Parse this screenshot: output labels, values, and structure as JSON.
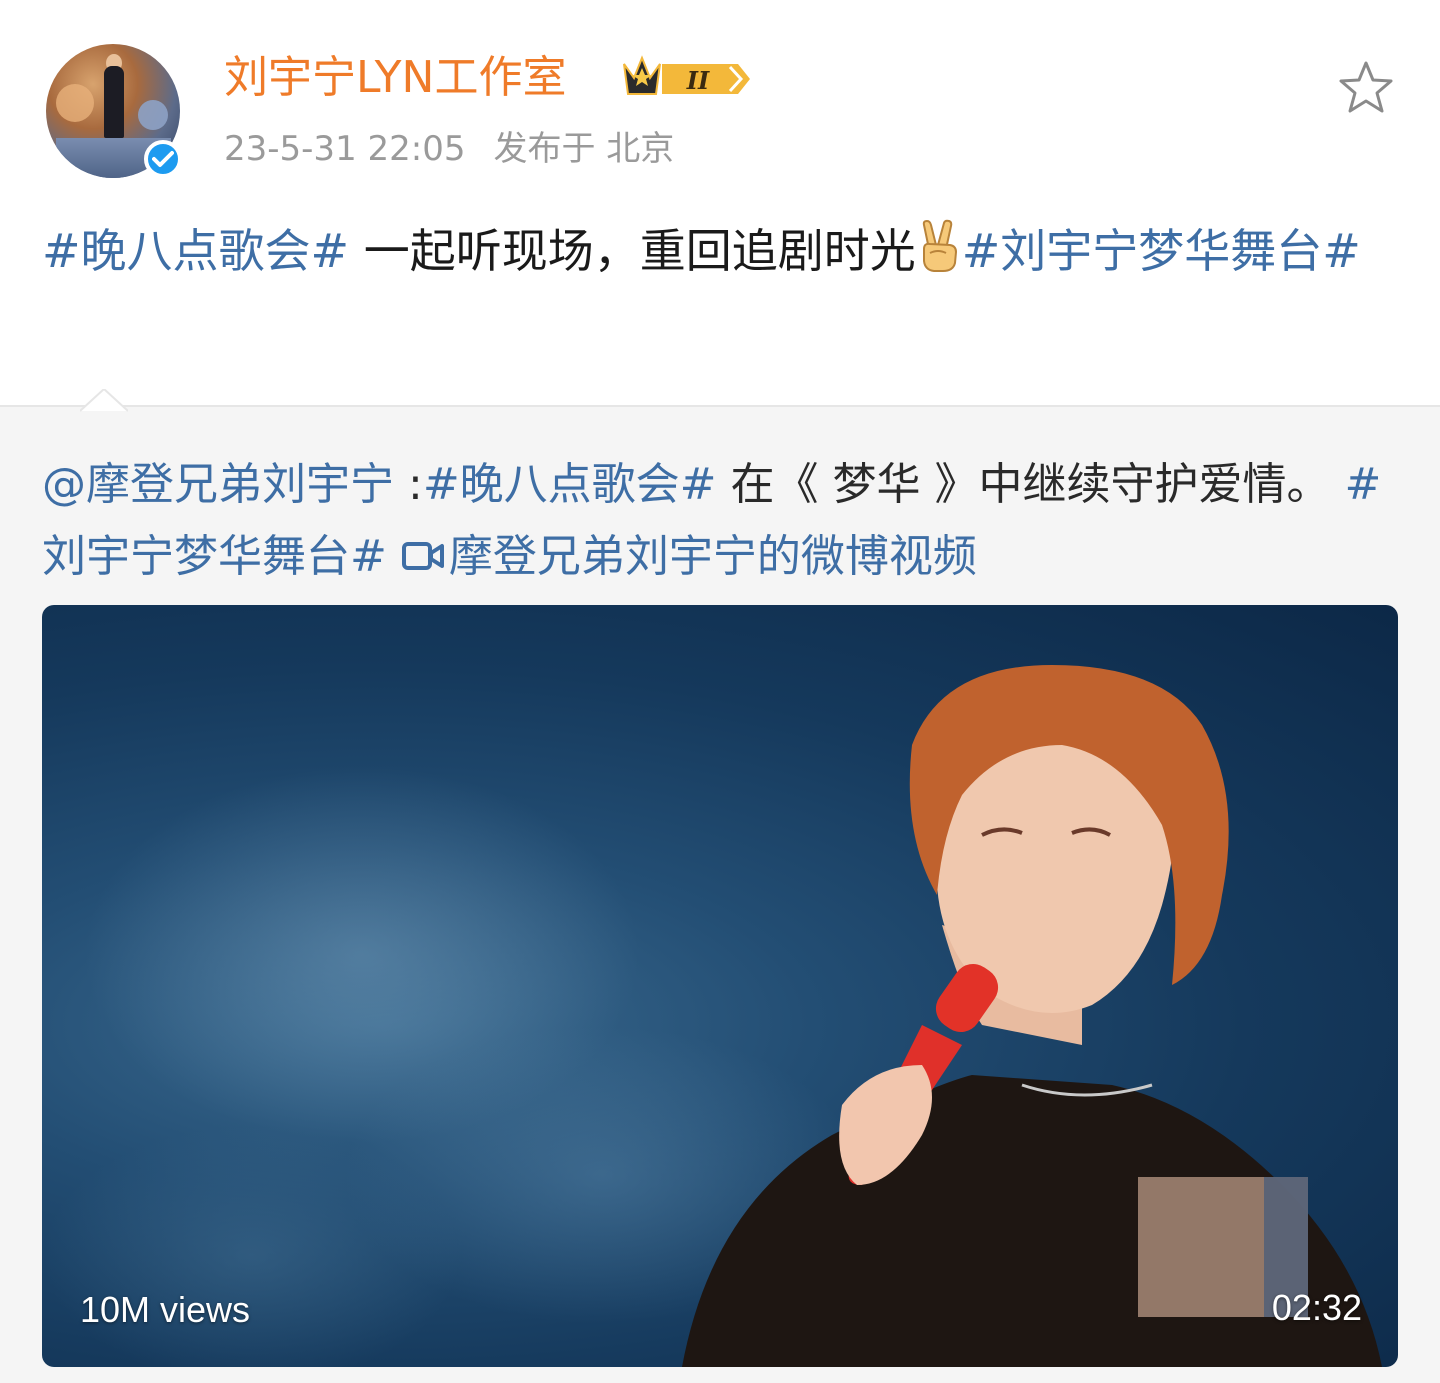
{
  "author": {
    "name": "刘宇宁LYN工作室",
    "avatar_caption": "刘宇宁",
    "verified_icon": "verified-check-icon",
    "vip_badge_level": "II",
    "timestamp": "23-5-31 22:05",
    "location": "发布于 北京",
    "name_color": "#ef7b29"
  },
  "post": {
    "tag1": "#晚八点歌会#",
    "text1": " 一起听现场，重回追剧时光",
    "emoji": "victory-hand-emoji",
    "tag2": "#刘宇宁梦华舞台#"
  },
  "repost": {
    "mention": "@摩登兄弟刘宇宁",
    "separator": " :",
    "tag1": "#晚八点歌会#",
    "text1": " 在《 梦华 》中继续守护爱情。 ",
    "tag2": "#刘宇宁梦华舞台#",
    "video_link": "摩登兄弟刘宇宁的微博视频",
    "video_link_icon": "video-camera-icon"
  },
  "video": {
    "views": "10M views",
    "duration": "02:32"
  },
  "colors": {
    "link": "#3e6ea5",
    "meta": "#9a9a9a",
    "repost_bg": "#f5f5f5"
  }
}
